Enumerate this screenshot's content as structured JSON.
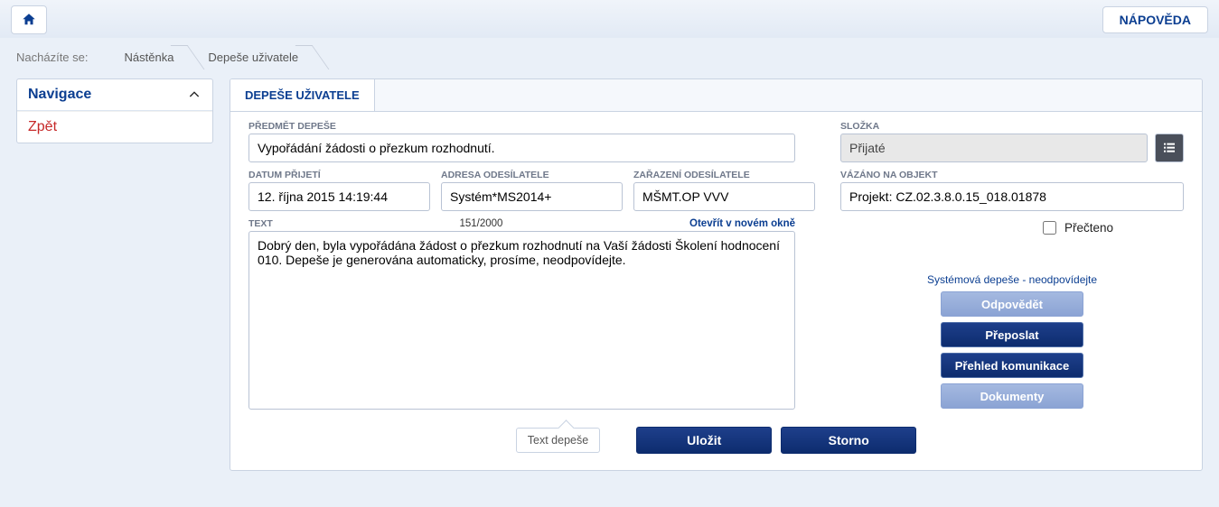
{
  "top": {
    "help": "NÁPOVĚDA"
  },
  "breadcrumb": {
    "label": "Nacházíte se:",
    "items": [
      "Nástěnka",
      "Depeše uživatele"
    ]
  },
  "nav": {
    "title": "Navigace",
    "back": "Zpět"
  },
  "tab": "DEPEŠE UŽIVATELE",
  "labels": {
    "subject": "PŘEDMĚT DEPEŠE",
    "received": "DATUM PŘIJETÍ",
    "sender_addr": "ADRESA ODESÍLATELE",
    "sender_role": "ZAŘAZENÍ ODESÍLATELE",
    "bound": "VÁZÁNO NA OBJEKT",
    "folder": "SLOŽKA",
    "text": "TEXT",
    "read": "Přečteno"
  },
  "values": {
    "subject": "Vypořádání žádosti o přezkum rozhodnutí.",
    "received": "12. října 2015 14:19:44",
    "sender_addr": "Systém*MS2014+",
    "sender_role": "MŠMT.OP VVV",
    "bound": "Projekt: CZ.02.3.8.0.15_018.01878",
    "folder": "Přijaté",
    "text": "Dobrý den, byla vypořádána žádost o přezkum rozhodnutí na Vaší žádosti Školení hodnocení 010. Depeše je generována automaticky, prosíme, neodpovídejte.",
    "counter": "151/2000",
    "open_link": "Otevřít v novém okně"
  },
  "note": "Systémová depeše - neodpovídejte",
  "actions": {
    "reply": "Odpovědět",
    "forward": "Přeposlat",
    "overview": "Přehled komunikace",
    "docs": "Dokumenty",
    "save": "Uložit",
    "cancel": "Storno"
  },
  "tooltip": "Text depeše"
}
